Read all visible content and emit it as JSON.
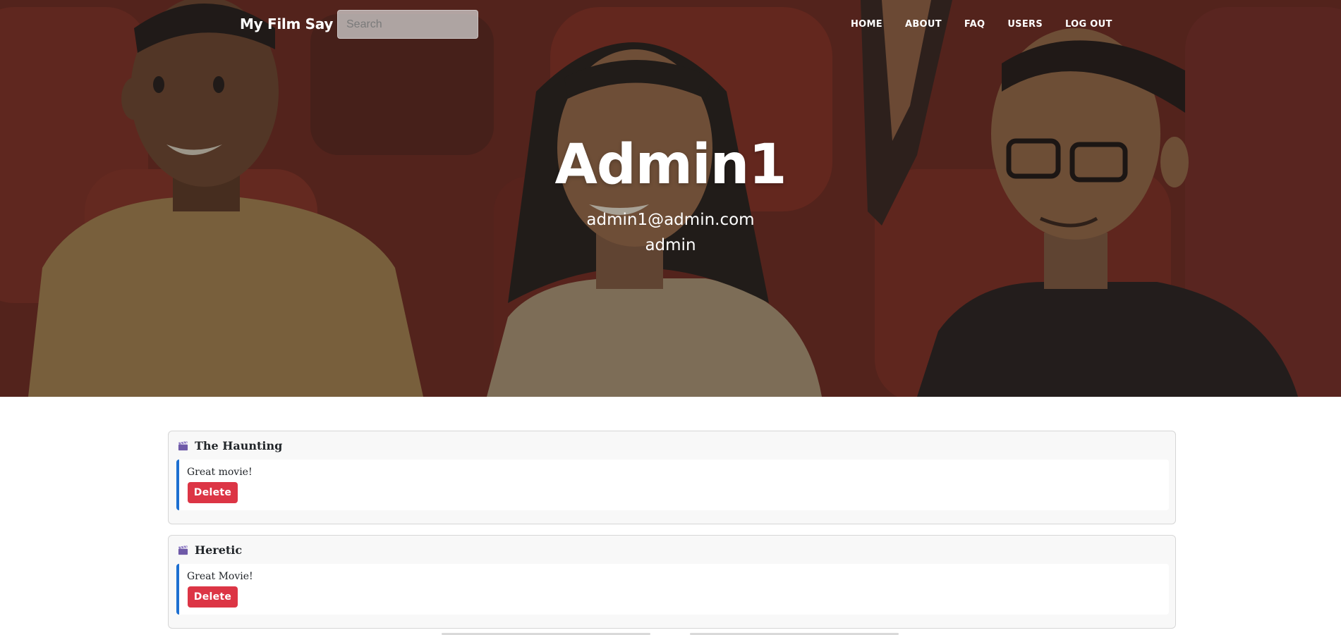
{
  "navbar": {
    "brand": "My Film Say",
    "search_placeholder": "Search",
    "links": [
      "HOME",
      "ABOUT",
      "FAQ",
      "USERS",
      "LOG OUT"
    ]
  },
  "profile": {
    "username": "Admin1",
    "email": "admin1@admin.com",
    "role": "admin"
  },
  "reviews": [
    {
      "icon": "clapperboard-icon",
      "film": "The Haunting",
      "text": "Great movie!",
      "delete_label": "Delete"
    },
    {
      "icon": "clapperboard-icon",
      "film": "Heretic",
      "text": "Great Movie!",
      "delete_label": "Delete"
    }
  ],
  "colors": {
    "hero_background": "#5e2a22",
    "delete_button": "#dc3545",
    "review_accent": "#1c6fd1",
    "nav_text": "#ffffff"
  }
}
